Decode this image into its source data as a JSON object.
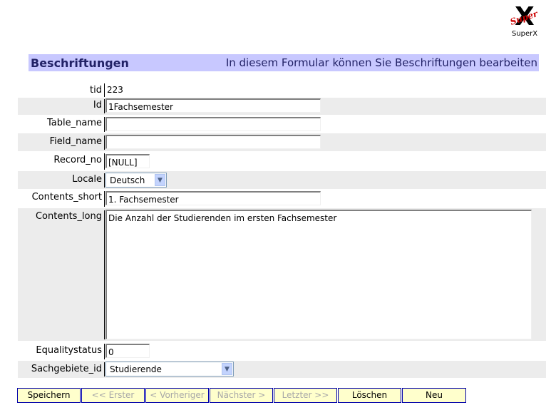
{
  "logo": {
    "mark": "X",
    "mark_super": "Super",
    "caption": "SuperX"
  },
  "header": {
    "title": "Beschriftungen",
    "subtitle": "In diesem Formular können Sie Beschriftungen bearbeiten"
  },
  "form": {
    "tid": {
      "label": "tid",
      "value": "223"
    },
    "id": {
      "label": "Id",
      "value": "1Fachsemester"
    },
    "table_name": {
      "label": "Table_name",
      "value": ""
    },
    "field_name": {
      "label": "Field_name",
      "value": ""
    },
    "record_no": {
      "label": "Record_no",
      "value": "[NULL]"
    },
    "locale": {
      "label": "Locale",
      "value": "Deutsch"
    },
    "contents_short": {
      "label": "Contents_short",
      "value": "1. Fachsemester"
    },
    "contents_long": {
      "label": "Contents_long",
      "value": "Die Anzahl der Studierenden im ersten Fachsemester"
    },
    "equalitystatus": {
      "label": "Equalitystatus",
      "value": "0"
    },
    "sachgebiete_id": {
      "label": "Sachgebiete_id",
      "value": "Studierende"
    }
  },
  "buttons": {
    "save": "Speichern",
    "first": "<< Erster",
    "previous": "< Vorheriger",
    "next": "Nächster >",
    "last": "Letzter >>",
    "delete": "Löschen",
    "new": "Neu"
  },
  "colors": {
    "header_bg": "#c8c8ff",
    "row_shade": "#ececec",
    "button_bg": "#ffffcc",
    "button_border": "#0000aa"
  }
}
